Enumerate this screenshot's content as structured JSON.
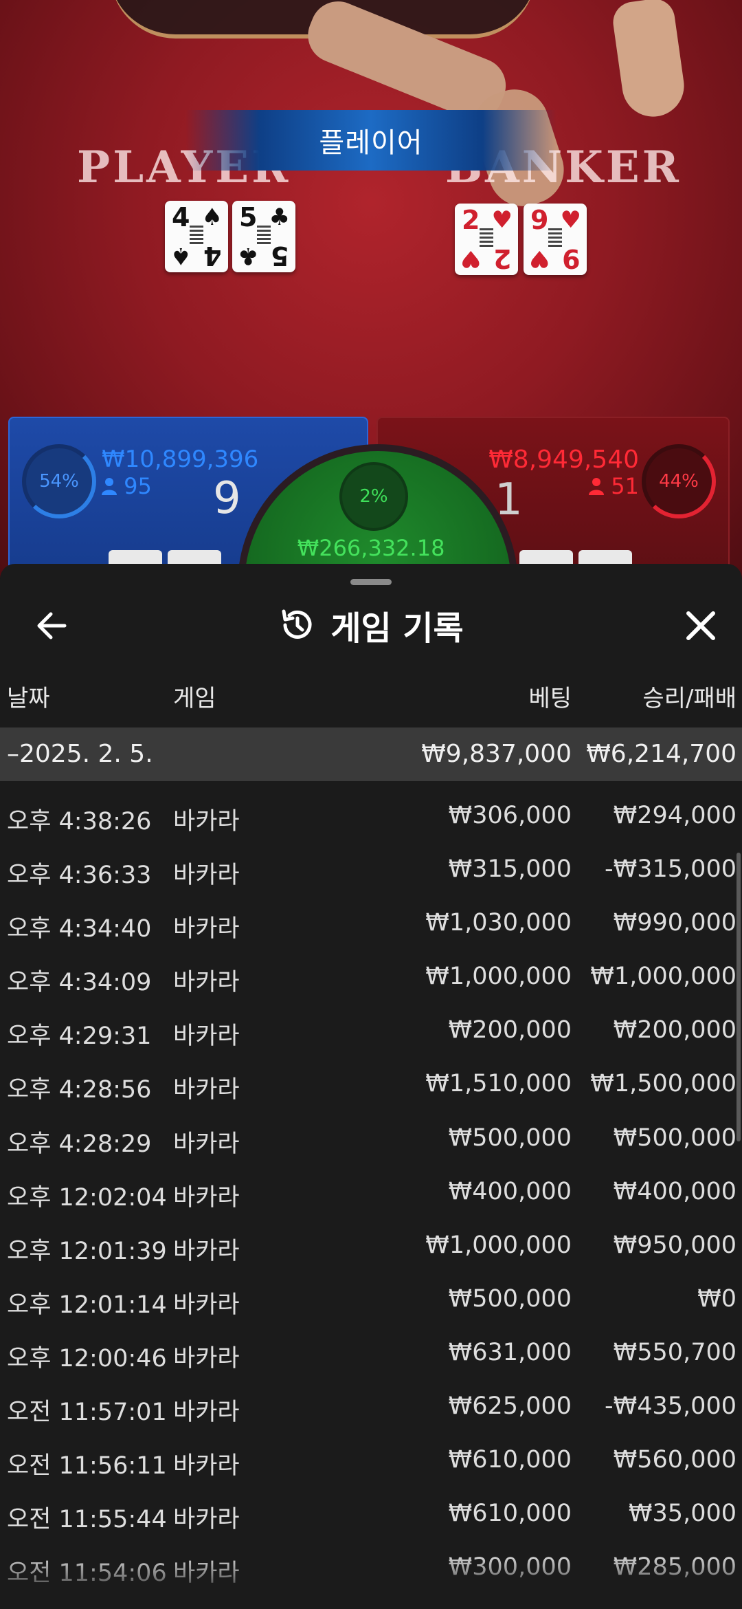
{
  "table": {
    "banner_label": "플레이어",
    "player_word": "PLAYER",
    "banker_word": "BANKER",
    "player_cards": [
      {
        "rank": "4",
        "suit": "♠",
        "color": "#111111"
      },
      {
        "rank": "5",
        "suit": "♣",
        "color": "#111111"
      }
    ],
    "banker_cards": [
      {
        "rank": "2",
        "suit": "♥",
        "color": "#d0202e"
      },
      {
        "rank": "9",
        "suit": "♥",
        "color": "#d0202e"
      }
    ]
  },
  "bets": {
    "player": {
      "percent": "54%",
      "amount": "₩10,899,396",
      "count": "95",
      "score": "9"
    },
    "tie": {
      "percent": "2%",
      "amount": "₩266,332.18"
    },
    "banker": {
      "percent": "44%",
      "amount": "₩8,949,540",
      "count": "51",
      "score": "1"
    }
  },
  "sheet": {
    "title": "게임 기록",
    "columns": {
      "date": "날짜",
      "game": "게임",
      "bet": "베팅",
      "win_loss": "승리/패배"
    },
    "summary": {
      "date": "–2025. 2. 5.",
      "bet": "₩9,837,000",
      "win_loss": "₩6,214,700"
    },
    "rows": [
      {
        "time": "오후 4:38:26",
        "game": "바카라",
        "bet": "₩306,000",
        "win_loss": "₩294,000"
      },
      {
        "time": "오후 4:36:33",
        "game": "바카라",
        "bet": "₩315,000",
        "win_loss": "-₩315,000"
      },
      {
        "time": "오후 4:34:40",
        "game": "바카라",
        "bet": "₩1,030,000",
        "win_loss": "₩990,000"
      },
      {
        "time": "오후 4:34:09",
        "game": "바카라",
        "bet": "₩1,000,000",
        "win_loss": "₩1,000,000"
      },
      {
        "time": "오후 4:29:31",
        "game": "바카라",
        "bet": "₩200,000",
        "win_loss": "₩200,000"
      },
      {
        "time": "오후 4:28:56",
        "game": "바카라",
        "bet": "₩1,510,000",
        "win_loss": "₩1,500,000"
      },
      {
        "time": "오후 4:28:29",
        "game": "바카라",
        "bet": "₩500,000",
        "win_loss": "₩500,000"
      },
      {
        "time": "오후 12:02:04",
        "game": "바카라",
        "bet": "₩400,000",
        "win_loss": "₩400,000"
      },
      {
        "time": "오후 12:01:39",
        "game": "바카라",
        "bet": "₩1,000,000",
        "win_loss": "₩950,000"
      },
      {
        "time": "오후 12:01:14",
        "game": "바카라",
        "bet": "₩500,000",
        "win_loss": "₩0"
      },
      {
        "time": "오후 12:00:46",
        "game": "바카라",
        "bet": "₩631,000",
        "win_loss": "₩550,700"
      },
      {
        "time": "오전 11:57:01",
        "game": "바카라",
        "bet": "₩625,000",
        "win_loss": "-₩435,000"
      },
      {
        "time": "오전 11:56:11",
        "game": "바카라",
        "bet": "₩610,000",
        "win_loss": "₩560,000"
      },
      {
        "time": "오전 11:55:44",
        "game": "바카라",
        "bet": "₩610,000",
        "win_loss": "₩35,000"
      },
      {
        "time": "오전 11:54:06",
        "game": "바카라",
        "bet": "₩300,000",
        "win_loss": "₩285,000"
      }
    ]
  },
  "icons": {
    "back": "arrow-left-icon",
    "history": "history-icon",
    "close": "close-icon",
    "user": "user-icon"
  },
  "colors": {
    "player": "#2f88ff",
    "banker": "#ff2a36",
    "tie": "#44e25c",
    "sheet_bg": "#1b1b1b"
  }
}
